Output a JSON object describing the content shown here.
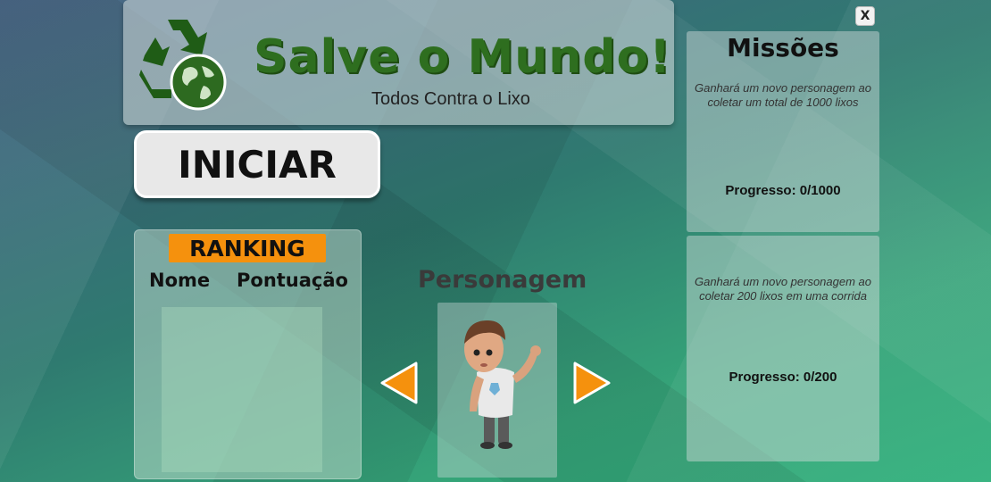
{
  "header": {
    "title": "Salve o Mundo!",
    "subtitle": "Todos Contra o Lixo"
  },
  "buttons": {
    "start_label": "INICIAR",
    "close_label": "X"
  },
  "ranking": {
    "badge": "RANKING",
    "col_name": "Nome",
    "col_score": "Pontuação",
    "rows": []
  },
  "character": {
    "title": "Personagem",
    "prev_icon": "triangle-left-icon",
    "next_icon": "triangle-right-icon"
  },
  "missions": {
    "title": "Missões",
    "items": [
      {
        "description": "Ganhará um novo personagem ao coletar um total de 1000 lixos",
        "progress": "Progresso: 0/1000"
      },
      {
        "description": "Ganhará um novo personagem ao coletar 200 lixos em uma corrida",
        "progress": "Progresso: 0/200"
      }
    ]
  },
  "colors": {
    "title_green": "#2e6e1f",
    "accent_orange": "#f5910d",
    "arrow_orange": "#f5910d"
  }
}
